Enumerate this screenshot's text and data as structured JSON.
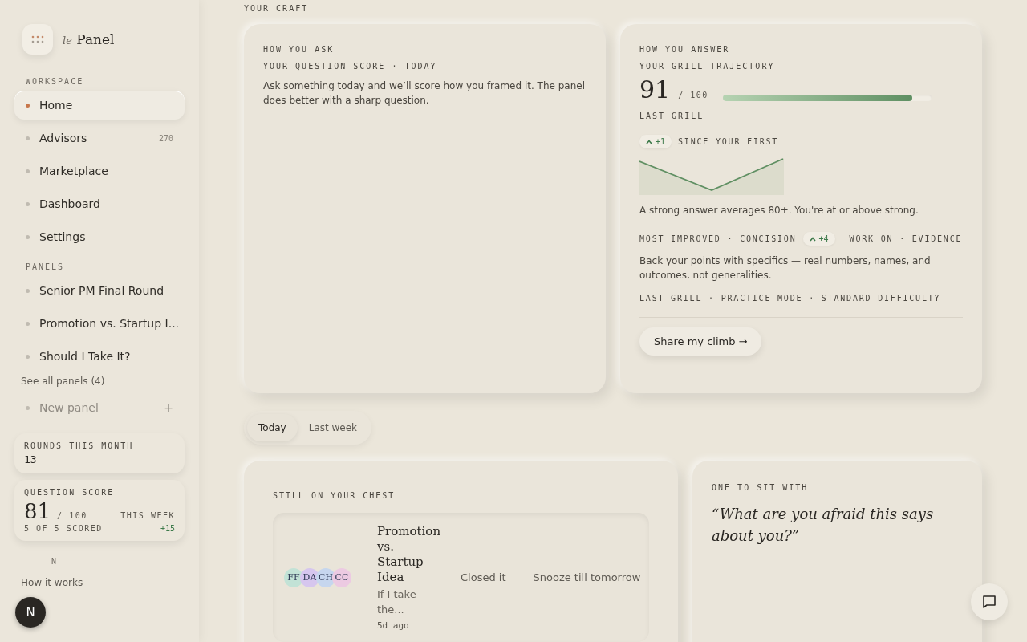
{
  "brand": {
    "prefix": "le",
    "name": "Panel"
  },
  "sidebar": {
    "sections": [
      {
        "label": "WORKSPACE",
        "items": [
          {
            "label": "Home",
            "selected": true
          },
          {
            "label": "Advisors",
            "selected": false,
            "count": "270"
          },
          {
            "label": "Marketplace",
            "selected": false
          },
          {
            "label": "Dashboard",
            "selected": false
          },
          {
            "label": "Settings",
            "selected": false
          }
        ]
      },
      {
        "label": "PANELS",
        "items": [
          {
            "label": "Senior PM Final Round",
            "selected": false
          },
          {
            "label": "Promotion vs. Startup I...",
            "selected": false
          },
          {
            "label": "Should I Take It?",
            "selected": false
          }
        ]
      }
    ],
    "see_all": "See all panels (4)",
    "new_panel": "New panel",
    "new_panel_icon": "+",
    "rounds": {
      "label": "ROUNDS THIS MONTH",
      "value": "13"
    },
    "question_score": {
      "label": "QUESTION SCORE",
      "score": "81",
      "out_of": "/ 100",
      "period": "THIS WEEK",
      "scored": "5 OF 5 SCORED",
      "delta": "+15"
    },
    "learn_label": "N",
    "how_it_works": "How it works",
    "avatar": "N"
  },
  "section_title": "YOUR CRAFT",
  "ask_card": {
    "eyebrow": "HOW YOU ASK",
    "title": "YOUR QUESTION SCORE · TODAY",
    "body": "Ask something today and we’ll score how you framed it. The panel does better with a sharp question."
  },
  "answer_card": {
    "eyebrow": "HOW YOU ANSWER",
    "title": "YOUR GRILL TRAJECTORY",
    "score": "91",
    "out_of": "/ 100",
    "score_label": "LAST GRILL",
    "level": 0.91,
    "since_delta": "+1",
    "since_label": "SINCE YOUR FIRST",
    "strong_note": "A strong answer averages 80+. You're at or above strong.",
    "most_improved": "MOST IMPROVED · CONCISION",
    "improved_delta": "+4",
    "work_on": "WORK ON · EVIDENCE",
    "advice": "Back your points with specifics — real numbers, names, and outcomes, not generalities.",
    "meta": "LAST GRILL · PRACTICE MODE · STANDARD DIFFICULTY",
    "share": "Share my climb →"
  },
  "tabs": [
    {
      "label": "Today",
      "selected": true
    },
    {
      "label": "Last week",
      "selected": false
    }
  ],
  "chest_card": {
    "title": "STILL ON YOUR CHEST",
    "item": {
      "avatars": [
        {
          "initials": "FF",
          "color": "#c2e2d6"
        },
        {
          "initials": "DA",
          "color": "#d6c6ee"
        },
        {
          "initials": "CH",
          "color": "#c6d6ee"
        },
        {
          "initials": "CC",
          "color": "#eccae2"
        }
      ],
      "title": "Promotion vs. Startup Idea",
      "preview": "If I take the...",
      "age": "5d ago",
      "close": "Closed it",
      "snooze": "Snooze till tomorrow"
    }
  },
  "sit_card": {
    "title": "ONE TO SIT WITH",
    "quote": "“What are you afraid this says about you?”"
  }
}
